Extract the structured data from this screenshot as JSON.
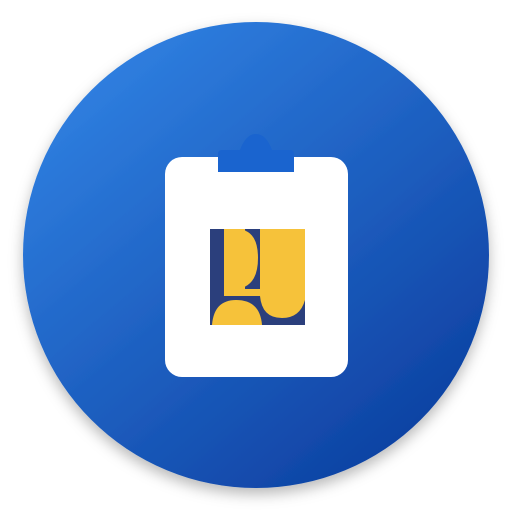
{
  "app_icon": {
    "icon_name": "clipboard-pu-logo-icon",
    "colors": {
      "circle_light": "#2f7fe0",
      "circle_dark": "#0c3fa0",
      "clipboard": "#ffffff",
      "clip": "#1a64cf",
      "logo_yellow": "#f6c23a",
      "logo_navy": "#2b3f7c"
    }
  }
}
